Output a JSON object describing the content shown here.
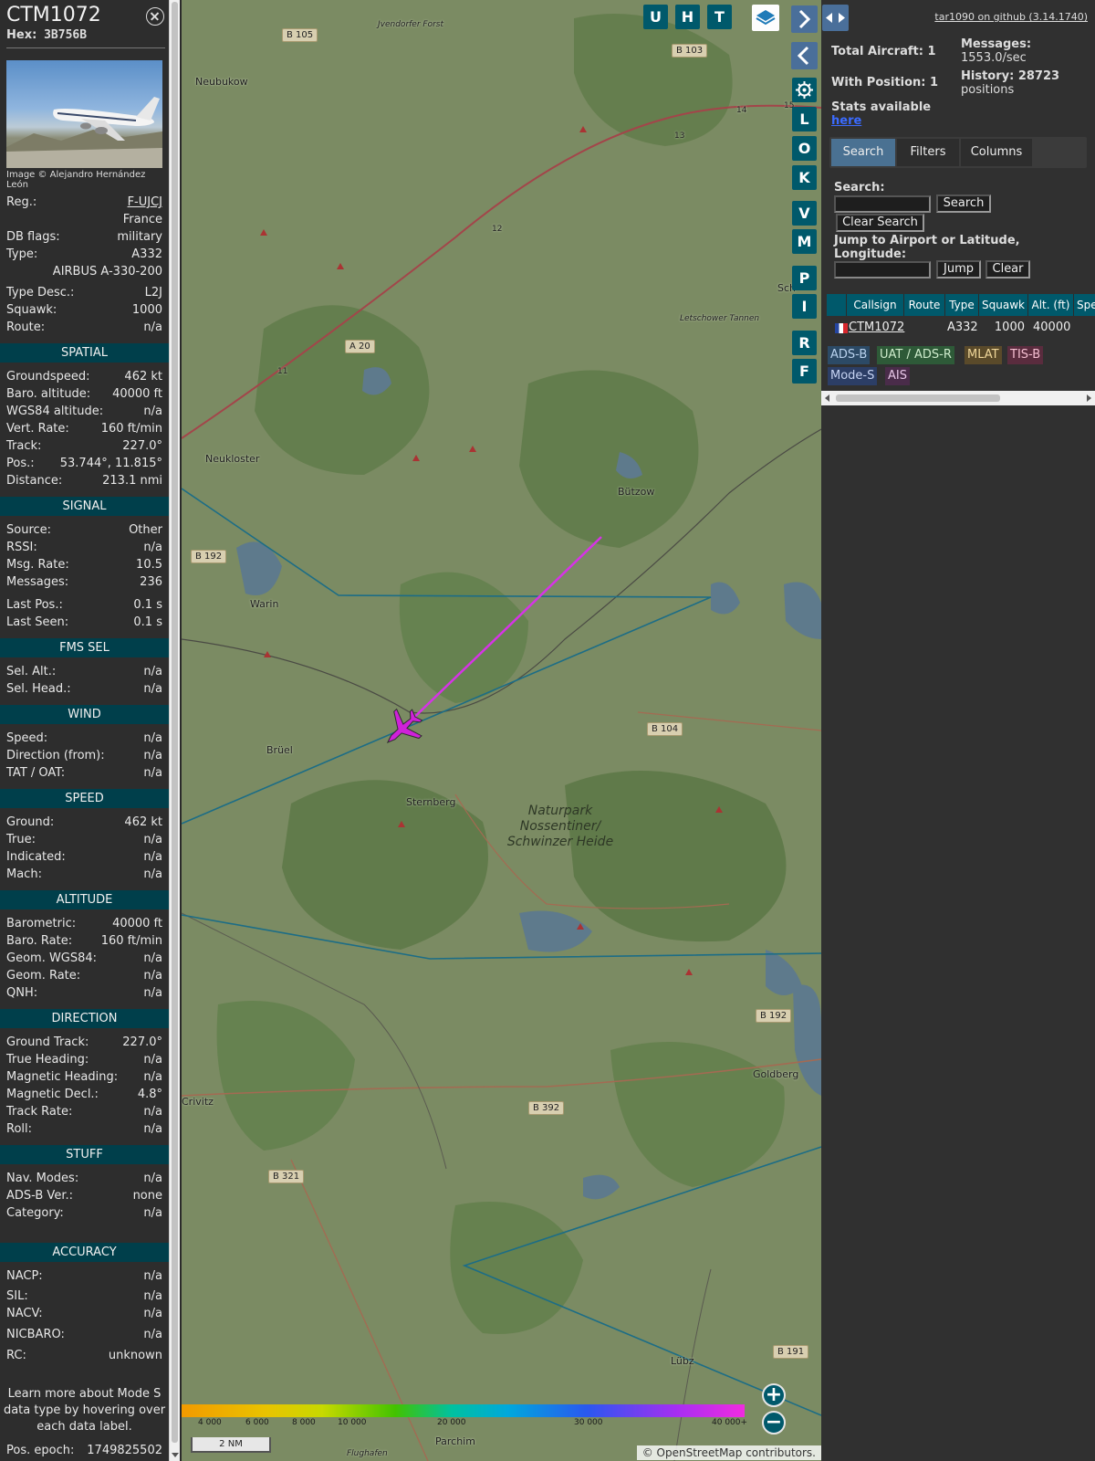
{
  "info": {
    "callsign": "CTM1072",
    "hex_label": "Hex:",
    "hex_value": "3B756B",
    "photo_credit": "Image © Alejandro Hernández León",
    "rows": [
      {
        "k": "Reg.:",
        "v": "F-UJCJ"
      },
      {
        "k": "",
        "v": "France"
      },
      {
        "k": "DB flags:",
        "v": "military"
      },
      {
        "k": "Type:",
        "v": "A332"
      },
      {
        "k": "",
        "v": "AIRBUS A-330-200"
      },
      {
        "k": "Type Desc.:",
        "v": "L2J"
      },
      {
        "k": "Squawk:",
        "v": "1000"
      },
      {
        "k": "Route:",
        "v": "n/a"
      }
    ],
    "sections": [
      {
        "title": "SPATIAL",
        "rows": [
          {
            "k": "Groundspeed:",
            "v": "462 kt"
          },
          {
            "k": "Baro. altitude:",
            "v": "40000 ft"
          },
          {
            "k": "WGS84 altitude:",
            "v": "n/a"
          },
          {
            "k": "Vert. Rate:",
            "v": "160 ft/min"
          },
          {
            "k": "Track:",
            "v": "227.0°"
          },
          {
            "k": "Pos.:",
            "v": "53.744°, 11.815°"
          },
          {
            "k": "Distance:",
            "v": "213.1 nmi"
          }
        ]
      },
      {
        "title": "SIGNAL",
        "rows": [
          {
            "k": "Source:",
            "v": "Other"
          },
          {
            "k": "RSSI:",
            "v": "n/a"
          },
          {
            "k": "Msg. Rate:",
            "v": "10.5"
          },
          {
            "k": "Messages:",
            "v": "236"
          },
          {
            "k": "Last Pos.:",
            "v": "0.1 s"
          },
          {
            "k": "Last Seen:",
            "v": "0.1 s"
          }
        ]
      },
      {
        "title": "FMS SEL",
        "rows": [
          {
            "k": "Sel. Alt.:",
            "v": "n/a"
          },
          {
            "k": "Sel. Head.:",
            "v": "n/a"
          }
        ]
      },
      {
        "title": "WIND",
        "rows": [
          {
            "k": "Speed:",
            "v": "n/a"
          },
          {
            "k": "Direction (from):",
            "v": "n/a"
          },
          {
            "k": "TAT / OAT:",
            "v": "n/a"
          }
        ]
      },
      {
        "title": "SPEED",
        "rows": [
          {
            "k": "Ground:",
            "v": "462 kt"
          },
          {
            "k": "True:",
            "v": "n/a"
          },
          {
            "k": "Indicated:",
            "v": "n/a"
          },
          {
            "k": "Mach:",
            "v": "n/a"
          }
        ]
      },
      {
        "title": "ALTITUDE",
        "rows": [
          {
            "k": "Barometric:",
            "v": "40000 ft"
          },
          {
            "k": "Baro. Rate:",
            "v": "160 ft/min"
          },
          {
            "k": "Geom. WGS84:",
            "v": "n/a"
          },
          {
            "k": "Geom. Rate:",
            "v": "n/a"
          },
          {
            "k": "QNH:",
            "v": "n/a"
          }
        ]
      },
      {
        "title": "DIRECTION",
        "rows": [
          {
            "k": "Ground Track:",
            "v": "227.0°"
          },
          {
            "k": "True Heading:",
            "v": "n/a"
          },
          {
            "k": "Magnetic Heading:",
            "v": "n/a"
          },
          {
            "k": "Magnetic Decl.:",
            "v": "4.8°"
          },
          {
            "k": "Track Rate:",
            "v": "n/a"
          },
          {
            "k": "Roll:",
            "v": "n/a"
          }
        ]
      },
      {
        "title": "STUFF",
        "rows": [
          {
            "k": "Nav. Modes:",
            "v": "n/a"
          },
          {
            "k": "ADS-B Ver.:",
            "v": "none"
          },
          {
            "k": "Category:",
            "v": "n/a"
          }
        ]
      },
      {
        "title": "ACCURACY",
        "rows": [
          {
            "k": "NACP:",
            "v": "n/a"
          },
          {
            "k": "SIL:",
            "v": "n/a"
          },
          {
            "k": "NACV:",
            "v": "n/a"
          },
          {
            "k": "NICBARO:",
            "v": "n/a"
          },
          {
            "k": "RC:",
            "v": "unknown"
          }
        ]
      }
    ],
    "learn_more": "Learn more about Mode S data type by hovering over each data label.",
    "pos_epoch_label": "Pos. epoch:",
    "pos_epoch_value": "1749825502"
  },
  "map": {
    "buttons": [
      "U",
      "H",
      "T"
    ],
    "side_buttons": [
      "L",
      "O",
      "K",
      "V",
      "M",
      "P",
      "I",
      "R",
      "F"
    ],
    "places": [
      "Neubukow",
      "Neukloster",
      "Warin",
      "Brüel",
      "Sternberg",
      "Bützow",
      "Goldberg",
      "Parchim",
      "Lübz",
      "Crivitz",
      "Jvendorfer Forst",
      "Letschower Tannen",
      "Flughafen",
      "Sch"
    ],
    "park": "Naturpark Nossentiner/ Schwinzer Heide",
    "roads": [
      "B 105",
      "B 103",
      "A 20",
      "B 192",
      "B 104",
      "B 192",
      "B 392",
      "B 321",
      "B 191",
      "14",
      "13",
      "12",
      "11",
      "15"
    ],
    "alt_ticks": [
      "4 000",
      "6 000",
      "8 000",
      "10 000",
      "20 000",
      "30 000",
      "40 000+"
    ],
    "scale": "2 NM",
    "attribution": "© OpenStreetMap contributors.",
    "zoom_in": "+",
    "zoom_out": "−"
  },
  "right": {
    "github": "tar1090 on github (3.14.1740)",
    "total_aircraft": "Total Aircraft: 1",
    "with_position": "With Position: 1",
    "stats_available": "Stats available",
    "stats_link": "here",
    "messages_label": "Messages:",
    "messages_value": "1553.0/sec",
    "history_label": "History: 28723",
    "history_value": "positions",
    "tabs": [
      "Search",
      "Filters",
      "Columns"
    ],
    "search_label": "Search:",
    "search_button": "Search",
    "clear_search": "Clear Search",
    "jump_label": "Jump to Airport or Latitude, Longitude:",
    "jump_button": "Jump",
    "clear_button": "Clear",
    "columns": [
      "Callsign",
      "Route",
      "Type",
      "Squawk",
      "Alt. (ft)",
      "Spe"
    ],
    "aircraft": {
      "callsign": "CTM1072",
      "type": "A332",
      "squawk": "1000",
      "alt": "40000"
    },
    "sources": [
      {
        "label": "ADS-B",
        "bg": "#2c4a66",
        "color": "#b9d2ee"
      },
      {
        "label": "UAT / ADS-R",
        "bg": "#2e5a38",
        "color": "#cfeccc"
      },
      {
        "label": "MLAT",
        "bg": "#5a4a2a",
        "color": "#f0d79a"
      },
      {
        "label": "TIS-B",
        "bg": "#5a2c3e",
        "color": "#f6bfd2"
      },
      {
        "label": "Mode-S",
        "bg": "#2c3e66",
        "color": "#c6d3f2"
      },
      {
        "label": "AIS",
        "bg": "#4a2c4a",
        "color": "#e7c6e7"
      }
    ]
  },
  "colors": {
    "section_header": "#003f4b",
    "map_button": "#00596b",
    "track": "#d633e6",
    "aircraft": "#cf21d9"
  }
}
